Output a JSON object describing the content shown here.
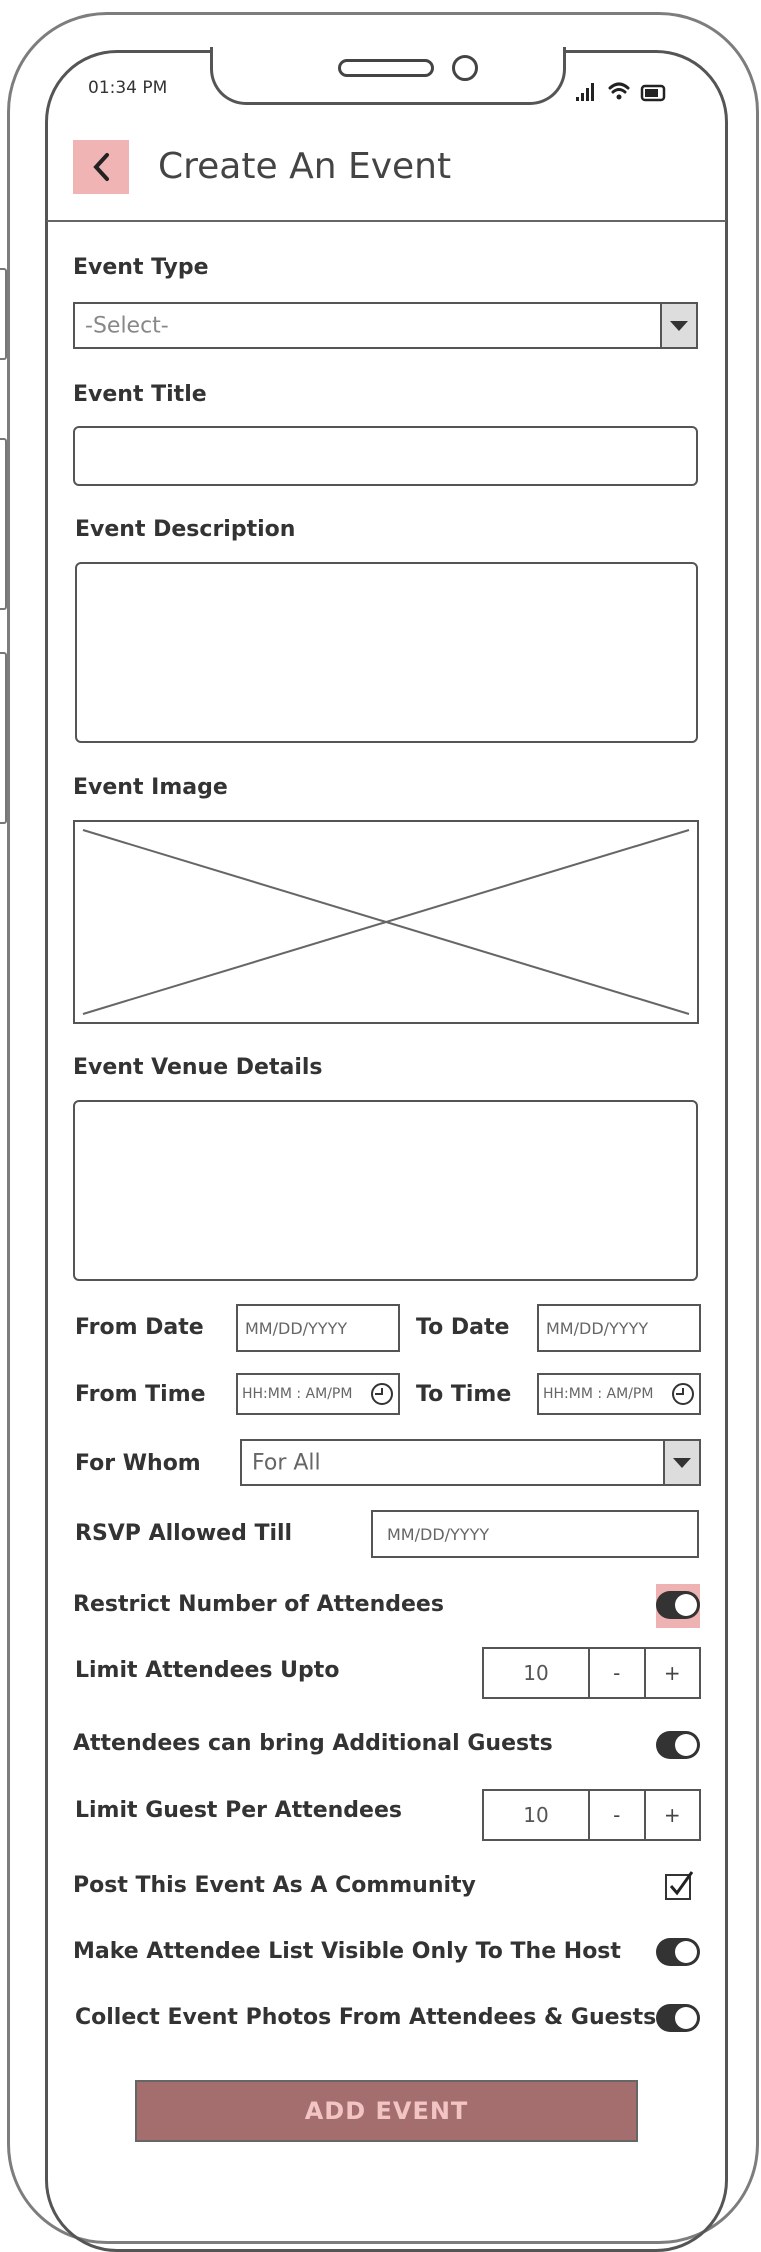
{
  "status_bar": {
    "time": "01:34 PM"
  },
  "header": {
    "title": "Create An Event"
  },
  "form": {
    "event_type": {
      "label": "Event Type",
      "value": "-Select-"
    },
    "event_title": {
      "label": "Event Title",
      "value": ""
    },
    "event_description": {
      "label": "Event Description",
      "value": ""
    },
    "event_image": {
      "label": "Event Image"
    },
    "event_venue": {
      "label": "Event Venue Details",
      "value": ""
    },
    "from_date": {
      "label": "From Date",
      "placeholder": "MM/DD/YYYY"
    },
    "to_date": {
      "label": "To Date",
      "placeholder": "MM/DD/YYYY"
    },
    "from_time": {
      "label": "From Time",
      "placeholder": "HH:MM : AM/PM"
    },
    "to_time": {
      "label": "To Time",
      "placeholder": "HH:MM : AM/PM"
    },
    "for_whom": {
      "label": "For Whom",
      "value": "For All"
    },
    "rsvp": {
      "label": "RSVP Allowed Till",
      "placeholder": "MM/DD/YYYY"
    },
    "restrict_attendees": {
      "label": "Restrict Number of Attendees",
      "on": true
    },
    "limit_attendees": {
      "label": "Limit Attendees Upto",
      "value": "10",
      "minus": "-",
      "plus": "+"
    },
    "additional_guests": {
      "label": "Attendees can bring Additional Guests",
      "on": true
    },
    "limit_guests": {
      "label": "Limit Guest Per Attendees",
      "value": "10",
      "minus": "-",
      "plus": "+"
    },
    "post_community": {
      "label": "Post This Event As A Community",
      "checked": true
    },
    "attendee_list_host": {
      "label": "Make Attendee List Visible Only To The Host",
      "on": true
    },
    "collect_photos": {
      "label": "Collect Event Photos From Attendees & Guests",
      "on": true
    }
  },
  "actions": {
    "add_event": "ADD EVENT"
  },
  "colors": {
    "accent": "#efb2b2",
    "button": "#a46e6e",
    "button_text": "#f3c4c4"
  }
}
